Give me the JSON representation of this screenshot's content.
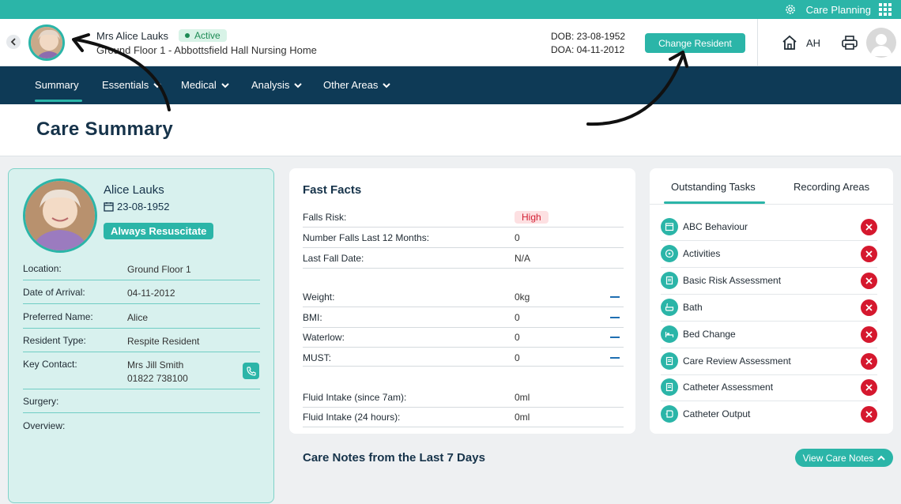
{
  "topbar": {
    "app_label": "Care Planning",
    "settings_icon": "gear-icon",
    "apps_icon": "grid-icon"
  },
  "resident": {
    "name": "Mrs Alice Lauks",
    "status": "Active",
    "location": "Ground Floor 1 - Abbottsfield Hall Nursing Home",
    "dob": "DOB: 23-08-1952",
    "doa": "DOA: 04-11-2012",
    "change_label": "Change Resident"
  },
  "user": {
    "initials": "AH"
  },
  "nav": {
    "items": [
      {
        "label": "Summary",
        "active": true
      },
      {
        "label": "Essentials",
        "dropdown": true
      },
      {
        "label": "Medical",
        "dropdown": true
      },
      {
        "label": "Analysis",
        "dropdown": true
      },
      {
        "label": "Other Areas",
        "dropdown": true
      }
    ]
  },
  "page": {
    "title": "Care Summary"
  },
  "profile": {
    "name": "Alice Lauks",
    "dob": "23-08-1952",
    "resus": "Always Resuscitate",
    "details": [
      {
        "key": "Location:",
        "value": "Ground Floor 1"
      },
      {
        "key": "Date of Arrival:",
        "value": "04-11-2012"
      },
      {
        "key": "Preferred Name:",
        "value": "Alice"
      },
      {
        "key": "Resident Type:",
        "value": "Respite Resident"
      },
      {
        "key": "Key Contact:",
        "value": "Mrs Jill Smith",
        "value2": "01822 738100"
      },
      {
        "key": "Surgery:",
        "value": ""
      },
      {
        "key": "Overview:",
        "value": ""
      }
    ]
  },
  "facts": {
    "title": "Fast Facts",
    "rows": [
      {
        "key": "Falls Risk:",
        "value": "High"
      },
      {
        "key": "Number Falls Last 12 Months:",
        "value": "0"
      },
      {
        "key": "Last Fall Date:",
        "value": "N/A"
      },
      {
        "key": "Weight:",
        "value": "0kg"
      },
      {
        "key": "BMI:",
        "value": "0"
      },
      {
        "key": "Waterlow:",
        "value": "0"
      },
      {
        "key": "MUST:",
        "value": "0"
      },
      {
        "key": "Fluid Intake (since 7am):",
        "value": "0ml"
      },
      {
        "key": "Fluid Intake (24 hours):",
        "value": "0ml"
      }
    ]
  },
  "tasks": {
    "tabs": [
      {
        "label": "Outstanding Tasks",
        "active": true
      },
      {
        "label": "Recording Areas"
      }
    ],
    "items": [
      {
        "label": "ABC Behaviour",
        "icon": "calendar-icon"
      },
      {
        "label": "Activities",
        "icon": "activities-icon"
      },
      {
        "label": "Basic Risk Assessment",
        "icon": "document-icon"
      },
      {
        "label": "Bath",
        "icon": "bath-icon"
      },
      {
        "label": "Bed Change",
        "icon": "bed-icon"
      },
      {
        "label": "Care Review Assessment",
        "icon": "document-icon"
      },
      {
        "label": "Catheter Assessment",
        "icon": "document-icon"
      },
      {
        "label": "Catheter Output",
        "icon": "catheter-icon"
      }
    ]
  },
  "notes": {
    "title": "Care Notes from the Last 7 Days",
    "view_label": "View Care Notes"
  },
  "colors": {
    "accent": "#2bb5a8",
    "nav": "#0e3a56",
    "danger": "#d5182e",
    "title": "#16334a"
  }
}
